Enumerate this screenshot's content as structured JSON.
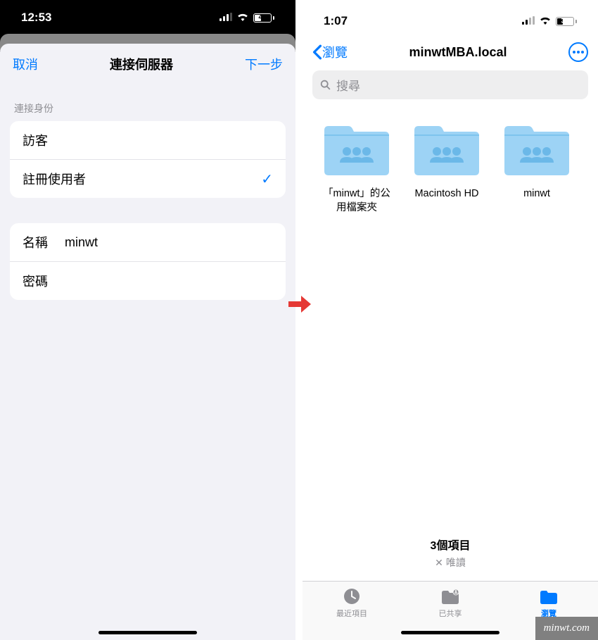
{
  "left": {
    "status": {
      "time": "12:53",
      "battery": 41
    },
    "modal": {
      "cancel": "取消",
      "title": "連接伺服器",
      "next": "下一步",
      "section_label": "連接身份",
      "options": [
        {
          "label": "訪客",
          "selected": false
        },
        {
          "label": "註冊使用者",
          "selected": true
        }
      ],
      "name_label": "名稱",
      "name_value": "minwt",
      "password_label": "密碼"
    }
  },
  "right": {
    "status": {
      "time": "1:07",
      "battery": 38
    },
    "nav": {
      "back": "瀏覽",
      "title": "minwtMBA.local"
    },
    "search_placeholder": "搜尋",
    "folders": [
      {
        "name": "「minwt」的公用檔案夾"
      },
      {
        "name": "Macintosh HD"
      },
      {
        "name": "minwt"
      }
    ],
    "footer": {
      "count": "3個項目",
      "readonly": "唯讀"
    },
    "tabs": [
      {
        "label": "最近項目",
        "active": false
      },
      {
        "label": "已共享",
        "active": false
      },
      {
        "label": "瀏覽",
        "active": true
      }
    ]
  },
  "watermark": "minwt.com"
}
